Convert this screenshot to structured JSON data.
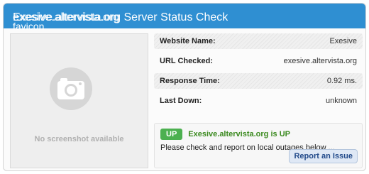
{
  "header": {
    "favicon_alt_1": "exesive.altervista.org",
    "favicon_alt_2": "favicon",
    "title": "Exesive.altervista.org Server Status Check"
  },
  "screenshot": {
    "placeholder_text": "No screenshot available",
    "icon": "camera-icon"
  },
  "details": [
    {
      "label": "Website Name:",
      "value": "Exesive"
    },
    {
      "label": "URL Checked:",
      "value": "exesive.altervista.org"
    },
    {
      "label": "Response Time:",
      "value": "0.92 ms."
    },
    {
      "label": "Last Down:",
      "value": "unknown"
    }
  ],
  "status": {
    "badge": "UP",
    "message": "Exesive.altervista.org is UP",
    "note": "Please check and report on local outages below ...",
    "report_button": "Report an Issue"
  },
  "colors": {
    "header_bg": "#2f8fd2",
    "up_badge": "#4cb050",
    "up_text": "#3b8a1f"
  }
}
